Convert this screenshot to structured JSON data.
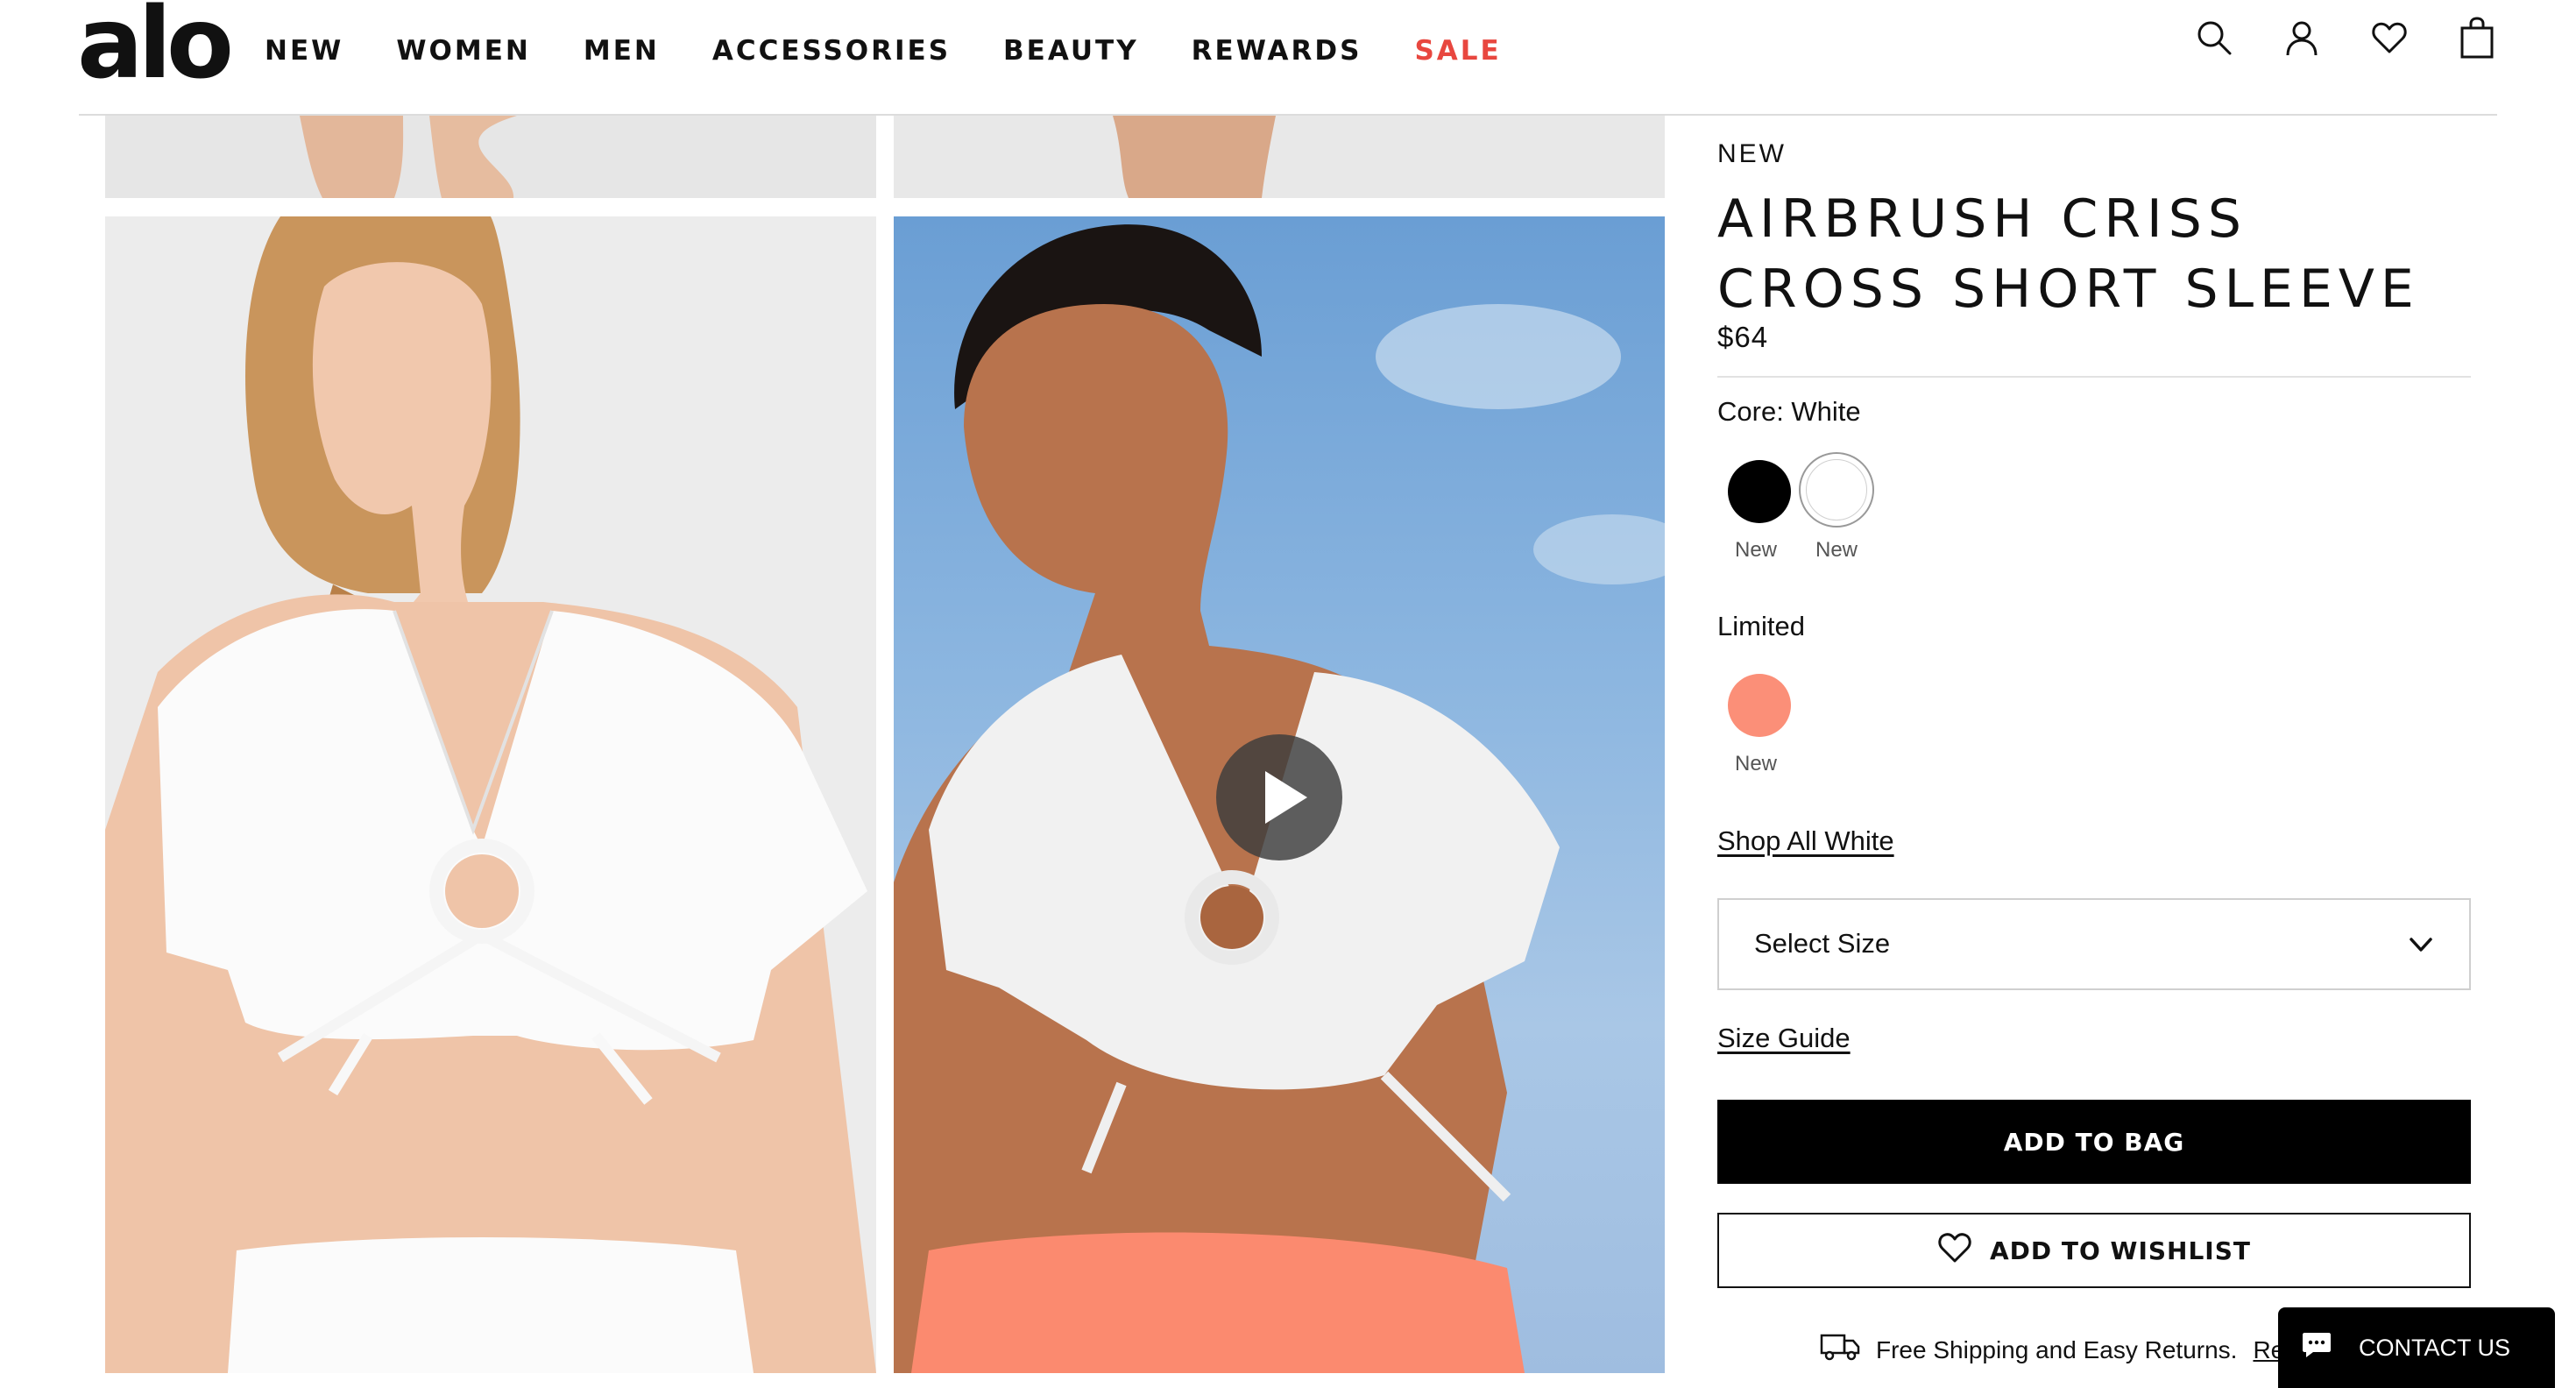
{
  "brand": {
    "logo_text": "alo"
  },
  "nav": {
    "items": [
      "NEW",
      "WOMEN",
      "MEN",
      "ACCESSORIES",
      "BEAUTY",
      "REWARDS"
    ],
    "sale": "SALE",
    "sale_color": "#e8473f"
  },
  "header_icons": [
    "search-icon",
    "account-icon",
    "wishlist-heart-icon",
    "shopping-bag-icon"
  ],
  "product": {
    "badge": "NEW",
    "title": "AIRBRUSH CRISS CROSS SHORT SLEEVE",
    "price": "$64",
    "color_label": "Core: White",
    "core_swatches": [
      {
        "name": "Black",
        "color": "#000000",
        "caption": "New"
      },
      {
        "name": "White",
        "color": "#ffffff",
        "caption": "New",
        "selected": true
      }
    ],
    "limited_label": "Limited",
    "limited_swatches": [
      {
        "name": "Coral",
        "color": "#fb8f78",
        "caption": "New"
      }
    ],
    "shop_all": "Shop All White",
    "size_select": {
      "label": "Select Size"
    },
    "size_guide": "Size Guide",
    "add_to_bag": "ADD TO BAG",
    "add_to_wishlist": "ADD TO WISHLIST",
    "shipping_text": "Free Shipping and Easy Returns.",
    "shipping_link": "Re"
  },
  "chat": {
    "label": "CONTACT US"
  }
}
